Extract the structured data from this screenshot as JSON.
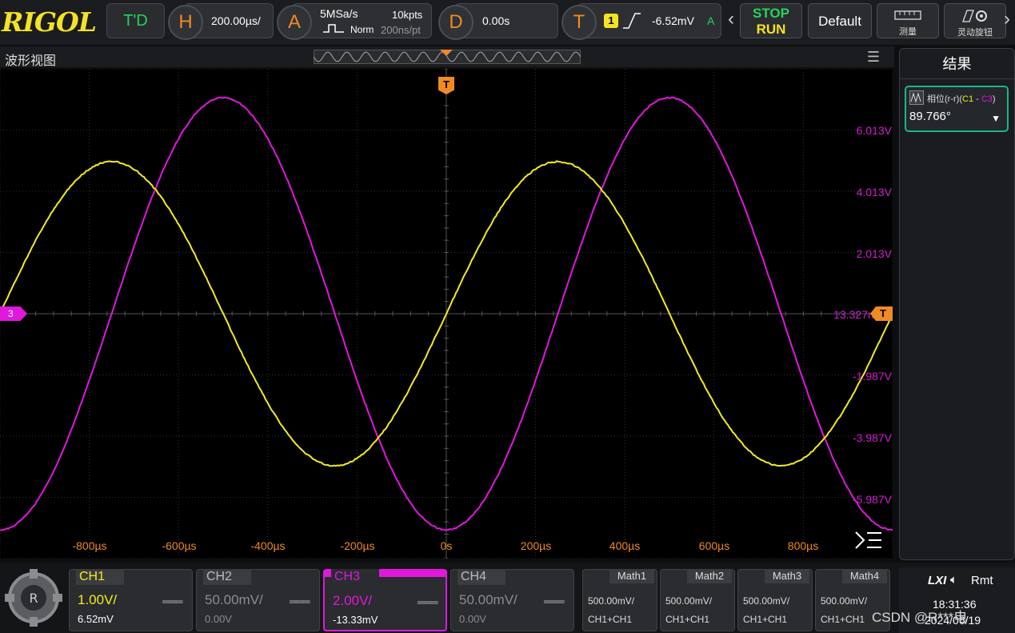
{
  "brand": "RIGOL",
  "topbar": {
    "td_label": "T'D",
    "horizontal": {
      "letter": "H",
      "value": "200.00µs/"
    },
    "acquire": {
      "letter": "A",
      "rate": "5MSa/s",
      "depth": "10kpts",
      "mode": "Norm",
      "time_per_pt": "200ns/pt"
    },
    "delay": {
      "letter": "D",
      "value": "0.00s"
    },
    "trigger": {
      "letter": "T",
      "source": "1",
      "level": "-6.52mV",
      "mode": "A"
    },
    "stop_label": "STOP",
    "run_label": "RUN",
    "default_label": "Default",
    "measure_label": "测量",
    "knob_label": "灵动旋钮",
    "colors": {
      "accent": "#f08a22",
      "stop": "#27d35a",
      "run": "#f4e225"
    }
  },
  "waveform": {
    "title": "波形视图",
    "trigger_marker": "T",
    "ch3_marker": "3",
    "level_label": "13.327mV",
    "y_labels": [
      "6.013V",
      "4.013V",
      "2.013V",
      "-1.987V",
      "-3.987V",
      "-5.987V"
    ],
    "x_labels": [
      "-800µs",
      "-600µs",
      "-400µs",
      "-200µs",
      "0s",
      "200µs",
      "400µs",
      "600µs",
      "800µs"
    ],
    "ch1_color": "#f2ec1e",
    "ch3_color": "#e018dc"
  },
  "results": {
    "title": "结果",
    "measure_name": "相位(r-r)",
    "measure_ch1": "C1",
    "measure_sep": " - ",
    "measure_ch3": "C3",
    "value": "89.766°"
  },
  "channels": [
    {
      "name": "CH1",
      "scale": "1.00V/",
      "offset": "6.52mV",
      "active": true,
      "color": "#f2ec1e"
    },
    {
      "name": "CH2",
      "scale": "50.00mV/",
      "offset": "0.00V",
      "active": false,
      "color": "#8a8c90"
    },
    {
      "name": "CH3",
      "scale": "2.00V/",
      "offset": "-13.33mV",
      "active": true,
      "color": "#e018dc"
    },
    {
      "name": "CH4",
      "scale": "50.00mV/",
      "offset": "0.00V",
      "active": false,
      "color": "#8a8c90"
    }
  ],
  "maths": [
    {
      "name": "Math1",
      "scale": "500.00mV/",
      "src": "CH1+CH1"
    },
    {
      "name": "Math2",
      "scale": "500.00mV/",
      "src": "CH1+CH1"
    },
    {
      "name": "Math3",
      "scale": "500.00mV/",
      "src": "CH1+CH1"
    },
    {
      "name": "Math4",
      "scale": "500.00mV/",
      "src": "CH1+CH1"
    }
  ],
  "status": {
    "lxi": "LXI",
    "remote": "Rmt",
    "time": "18:31:36",
    "date": "2024/06/19"
  },
  "watermark": "CSDN @R***电"
}
